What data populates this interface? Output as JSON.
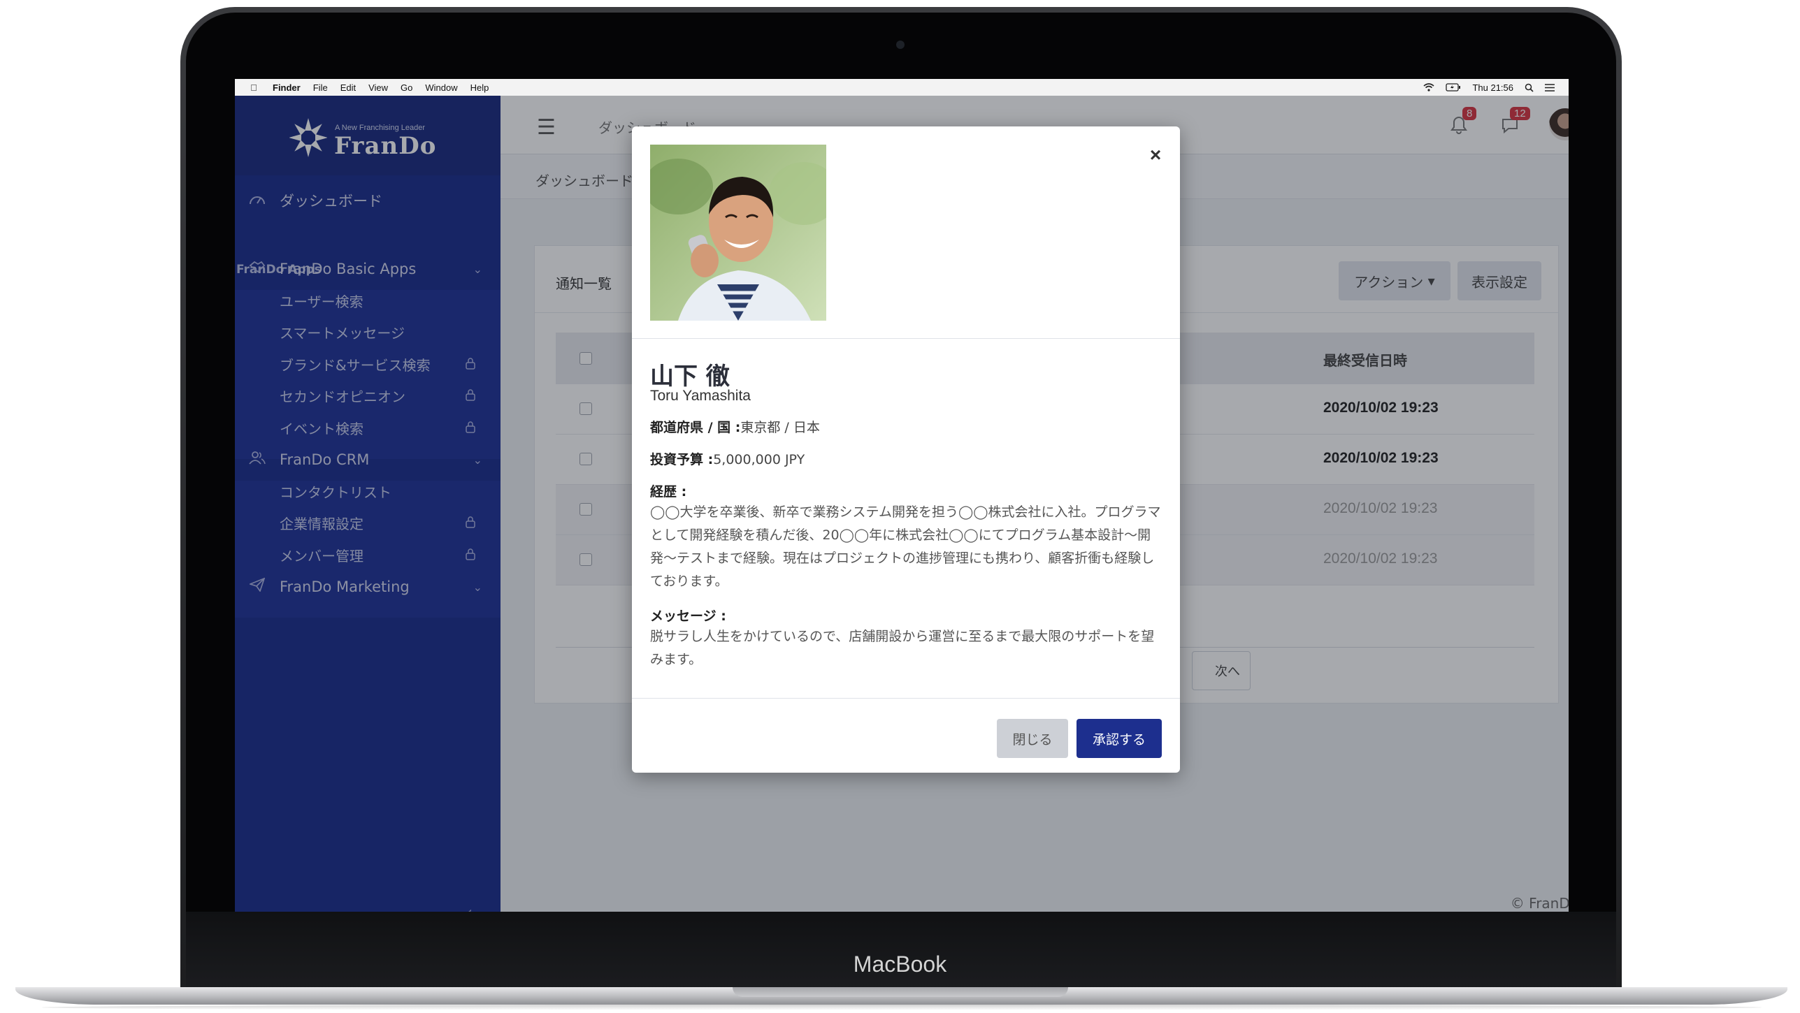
{
  "device": {
    "label": "MacBook"
  },
  "menubar": {
    "app": "Finder",
    "items": [
      "File",
      "Edit",
      "View",
      "Go",
      "Window",
      "Help"
    ],
    "clock": "Thu 21:56"
  },
  "sidebar": {
    "logo_tagline": "A New Franchising Leader",
    "logo_name": "FranDo",
    "dashboard": "ダッシュボード",
    "section_title": "FranDo Apps",
    "groups": [
      {
        "label": "FranDo Basic Apps",
        "icon": "handshake-icon",
        "items": [
          "ユーザー検索",
          "スマートメッセージ",
          "ブランド&サービス検索",
          "セカンドオピニオン",
          "イベント検索"
        ]
      },
      {
        "label": "FranDo CRM",
        "icon": "users-icon",
        "items": [
          "コンタクトリスト",
          "企業情報設定",
          "メンバー管理"
        ]
      },
      {
        "label": "FranDo Marketing",
        "icon": "paper-plane-icon",
        "items": []
      }
    ]
  },
  "topbar": {
    "title": "ダッシュボード",
    "notification_count": "8",
    "message_count": "12"
  },
  "breadcrumb": "ダッシュボード",
  "card": {
    "title": "通知一覧",
    "action_button": "アクション",
    "display_button": "表示設定",
    "column_last_received": "最終受信日時",
    "rows": [
      {
        "date": "2020/10/02 19:23",
        "unread": true
      },
      {
        "date": "2020/10/02 19:23",
        "unread": true
      },
      {
        "date": "2020/10/02 19:23",
        "unread": false
      },
      {
        "date": "2020/10/02 19:23",
        "unread": false
      }
    ],
    "next_button": "次へ"
  },
  "footer": {
    "copyright": "© FranDo"
  },
  "modal": {
    "name": "山下 徹",
    "romaji": "Toru Yamashita",
    "prefecture_label": "都道府県 / 国 :",
    "prefecture_value": "東京都 / 日本",
    "budget_label": "投資予算 :",
    "budget_value": "5,000,000 JPY",
    "career_label": "経歴 :",
    "career_text": "◯◯大学を卒業後、新卒で業務システム開発を担う◯◯株式会社に入社。プログラマとして開発経験を積んだ後、20◯◯年に株式会社◯◯にてプログラム基本設計〜開発〜テストまで経験。現在はプロジェクトの進捗管理にも携わり、顧客折衝も経験しております。",
    "message_label": "メッセージ :",
    "message_text": "脱サラし人生をかけているので、店舗開設から運営に至るまで最大限のサポートを望みます。",
    "close_button": "閉じる",
    "approve_button": "承認する"
  },
  "colors": {
    "sidebar": "#182a8c",
    "primary": "#1d2f8e",
    "badge": "#d9333f"
  }
}
